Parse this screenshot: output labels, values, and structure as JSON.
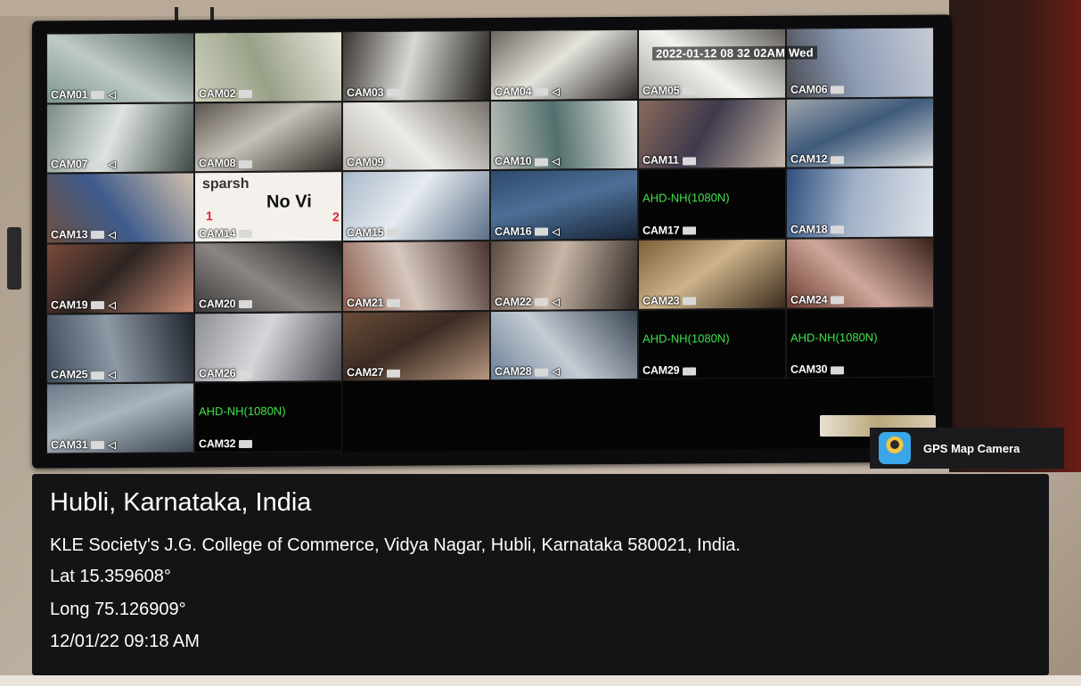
{
  "monitor": {
    "osd_datetime": "2022-01-12 08 32 02AM Wed",
    "tiles": [
      {
        "label": "CAM01",
        "kind": "video",
        "palette": [
          "#7e9590",
          "#bfcac7",
          "#4f5e5a"
        ]
      },
      {
        "label": "CAM02",
        "kind": "video",
        "palette": [
          "#cfd2bc",
          "#98a088",
          "#eae9dc"
        ]
      },
      {
        "label": "CAM03",
        "kind": "video",
        "palette": [
          "#3a3530",
          "#d8d8d2",
          "#1e1b18"
        ]
      },
      {
        "label": "CAM04",
        "kind": "video",
        "palette": [
          "#6b6760",
          "#e4e3dc",
          "#2e2a28"
        ]
      },
      {
        "label": "CAM05",
        "kind": "video",
        "palette": [
          "#a9a6a1",
          "#f2f2ef",
          "#625f5a"
        ]
      },
      {
        "label": "CAM06",
        "kind": "video",
        "palette": [
          "#4a4b52",
          "#8d9cb6",
          "#c8cbd5"
        ]
      },
      {
        "label": "CAM07",
        "kind": "video",
        "palette": [
          "#7d8c86",
          "#dde3e0",
          "#3e4a46"
        ]
      },
      {
        "label": "CAM08",
        "kind": "video",
        "palette": [
          "#5c5650",
          "#c6c1b8",
          "#302b27"
        ]
      },
      {
        "label": "CAM09",
        "kind": "video",
        "palette": [
          "#b8b4ad",
          "#ecebe7",
          "#77716a"
        ]
      },
      {
        "label": "CAM10",
        "kind": "video",
        "palette": [
          "#b9bdb6",
          "#53706e",
          "#e8ebe7"
        ]
      },
      {
        "label": "CAM11",
        "kind": "video",
        "palette": [
          "#8a6a5a",
          "#3f3a4d",
          "#c7b8a8"
        ]
      },
      {
        "label": "CAM12",
        "kind": "video",
        "palette": [
          "#9fa5ac",
          "#3f5a7a",
          "#d9dcdf"
        ]
      },
      {
        "label": "CAM13",
        "kind": "video",
        "palette": [
          "#6d5040",
          "#3e5b8c",
          "#d3c2ad"
        ]
      },
      {
        "label": "CAM14",
        "kind": "sparsh"
      },
      {
        "label": "CAM15",
        "kind": "video",
        "palette": [
          "#a9b8c9",
          "#e6ebf0",
          "#5b6f88"
        ]
      },
      {
        "label": "CAM16",
        "kind": "video",
        "palette": [
          "#2e4a6c",
          "#4d6f96",
          "#182437"
        ]
      },
      {
        "label": "CAM17",
        "kind": "nosignal"
      },
      {
        "label": "CAM18",
        "kind": "video",
        "palette": [
          "#2f4f7e",
          "#a1b1c7",
          "#dfe3ea"
        ]
      },
      {
        "label": "CAM19",
        "kind": "video",
        "palette": [
          "#7a4a3a",
          "#2d2422",
          "#c98c78"
        ]
      },
      {
        "label": "CAM20",
        "kind": "video",
        "palette": [
          "#3a3838",
          "#8a8682",
          "#1d1c1c"
        ]
      },
      {
        "label": "CAM21",
        "kind": "video",
        "palette": [
          "#8a5a4a",
          "#d6c8be",
          "#4a3430"
        ]
      },
      {
        "label": "CAM22",
        "kind": "video",
        "palette": [
          "#5a4a40",
          "#c7b6a6",
          "#2b2420"
        ]
      },
      {
        "label": "CAM23",
        "kind": "video",
        "palette": [
          "#7b6038",
          "#cdb38b",
          "#3b2c1c"
        ]
      },
      {
        "label": "CAM24",
        "kind": "video",
        "palette": [
          "#6a3a2e",
          "#cfa79a",
          "#382019"
        ]
      },
      {
        "label": "CAM25",
        "kind": "video",
        "palette": [
          "#3e4a58",
          "#8e99a6",
          "#1e242c"
        ]
      },
      {
        "label": "CAM26",
        "kind": "video",
        "palette": [
          "#8e8e96",
          "#d6d6da",
          "#484850"
        ]
      },
      {
        "label": "CAM27",
        "kind": "video",
        "palette": [
          "#6a4c3a",
          "#3b2c22",
          "#b79680"
        ]
      },
      {
        "label": "CAM28",
        "kind": "video",
        "palette": [
          "#6d8096",
          "#c4ccd4",
          "#3a4654"
        ]
      },
      {
        "label": "CAM29",
        "kind": "nosignal"
      },
      {
        "label": "CAM30",
        "kind": "nosignal"
      },
      {
        "label": "CAM31",
        "kind": "video",
        "palette": [
          "#6b7a88",
          "#a9b4bc",
          "#3b4652"
        ]
      },
      {
        "label": "CAM32",
        "kind": "nosignal"
      }
    ],
    "no_signal_text": "AHD-NH(1080N)",
    "sparsh": {
      "brand": "sparsh",
      "message": "No Vi",
      "n1": "1",
      "n2": "2"
    }
  },
  "gps_badge": {
    "app_name": "GPS Map Camera",
    "icon": "gps-map-camera-icon"
  },
  "location": {
    "city": "Hubli, Karnataka, India",
    "address": "KLE Society's J.G. College of Commerce, Vidya Nagar, Hubli, Karnataka 580021, India.",
    "lat": "Lat 15.359608°",
    "long": "Long 75.126909°",
    "timestamp": "12/01/22 09:18 AM"
  }
}
